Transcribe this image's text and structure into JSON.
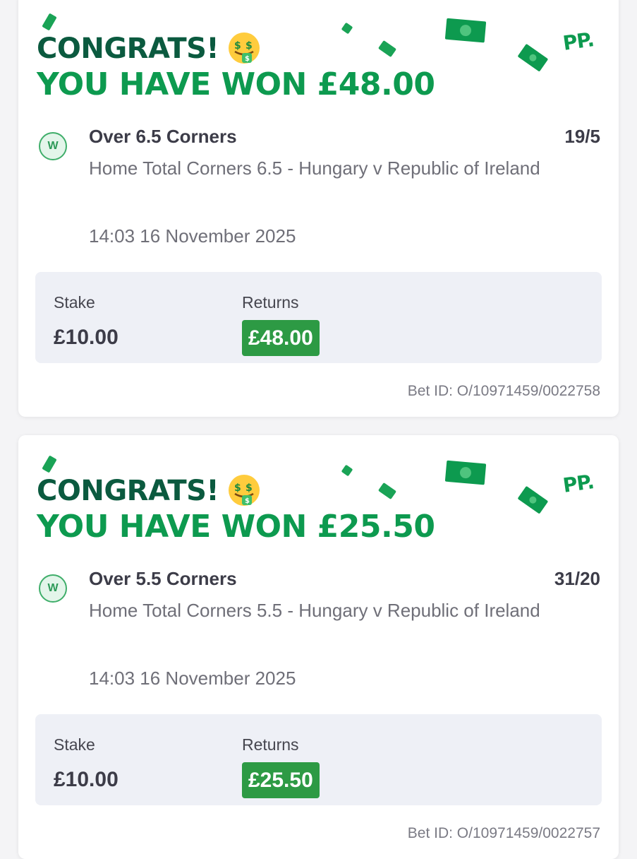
{
  "brand": {
    "logo_text": "PP.",
    "primary_green": "#0d9a4f",
    "dark_green": "#0b5a3f",
    "returns_badge_color": "#2d9a44"
  },
  "labels": {
    "stake": "Stake",
    "returns": "Returns"
  },
  "bets": [
    {
      "congrats_text": "CONGRATS!",
      "emoji_icon": "money-mouth-face",
      "won_text": "YOU HAVE WON £48.00",
      "status_letter": "W",
      "selection": "Over 6.5 Corners",
      "odds": "19/5",
      "market": "Home Total Corners 6.5 - Hungary v Republic of Ireland",
      "datetime": "14:03 16 November 2025",
      "stake": "£10.00",
      "returns": "£48.00",
      "bet_id": "Bet ID: O/10971459/0022758"
    },
    {
      "congrats_text": "CONGRATS!",
      "emoji_icon": "money-mouth-face",
      "won_text": "YOU HAVE WON £25.50",
      "status_letter": "W",
      "selection": "Over 5.5 Corners",
      "odds": "31/20",
      "market": "Home Total Corners 5.5 - Hungary v Republic of Ireland",
      "datetime": "14:03 16 November 2025",
      "stake": "£10.00",
      "returns": "£25.50",
      "bet_id": "Bet ID: O/10971459/0022757"
    }
  ]
}
